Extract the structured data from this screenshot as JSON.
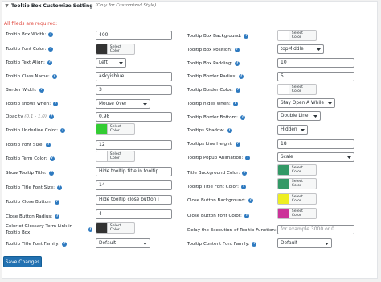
{
  "header": {
    "title": "Tooltip Box Customize Setting",
    "subtitle": "(Only for Customized Style)"
  },
  "required_note": "All fileds are required:",
  "color_button_label": "Select Color",
  "colors": {
    "tooltip_bg": "#ffffff",
    "font_color": "#333333",
    "border_color": "#ffffff",
    "underline": "#33cc33",
    "term_color": "#ffffff",
    "title_bg": "#339966",
    "title_font": "#339966",
    "close_btn_bg": "#eeee22",
    "close_btn_font": "#cc3399",
    "glossary_link": "#333333"
  },
  "left": {
    "box_width": {
      "label": "Tooltip Box Width:",
      "value": "400"
    },
    "font_color": {
      "label": "Tooltip Font Color:"
    },
    "text_align": {
      "label": "Tooltip Text Align:",
      "value": "Left"
    },
    "class_name": {
      "label": "Tooltip Class Name:",
      "value": "askyisblue"
    },
    "border_width": {
      "label": "Border Width:",
      "value": "3"
    },
    "shows_when": {
      "label": "Tooltip shows when:",
      "value": "Mouse Over"
    },
    "opacity": {
      "label": "Opacity",
      "hint": "(0.1 - 1.0)",
      "value": "0.98"
    },
    "underline_color": {
      "label": "Tooltip Underline Color:"
    },
    "font_size": {
      "label": "Tooltip Font Size:",
      "value": "12"
    },
    "term_color": {
      "label": "Tooltip Term Color:"
    },
    "show_title": {
      "label": "Show Tooltip Title:",
      "value": "Hide tooltip title in tooltip"
    },
    "title_font_size": {
      "label": "Tooltip Title Font Size:",
      "value": "14"
    },
    "close_button": {
      "label": "Tooltip Close Button:",
      "value": "Hide tooltip close button i"
    },
    "close_radius": {
      "label": "Close Button Radius:",
      "value": "4"
    },
    "glossary_color": {
      "label": "Color of Glossary Term Link in Tooltip Box:"
    },
    "title_font_family": {
      "label": "Tooltip Title Font Family:",
      "value": "Default"
    }
  },
  "right": {
    "box_bg": {
      "label": "Tooltip Box Background:"
    },
    "position": {
      "label": "Tooltip Box Position:",
      "value": "topMiddle"
    },
    "padding": {
      "label": "Tooltip Box Padding:",
      "value": "10"
    },
    "border_radius": {
      "label": "Tooltip Border Radius:",
      "value": "5"
    },
    "border_color": {
      "label": "Tooltip Border Color:"
    },
    "hides_when": {
      "label": "Tooltip hides when:",
      "value": "Stay Open A While"
    },
    "border_bottom": {
      "label": "Tooltip Border Bottom:",
      "value": "Double Line"
    },
    "shadow": {
      "label": "Tooltips Shadow:",
      "value": "Hidden"
    },
    "line_height": {
      "label": "Tooltips Line Height:",
      "value": "18"
    },
    "animation": {
      "label": "Tooltip Popup Animation:",
      "value": "Scale"
    },
    "title_bg": {
      "label": "Title Background Color:"
    },
    "title_font_color": {
      "label": "Tooltip Title Font Color:"
    },
    "close_bg": {
      "label": "Close Button Background:"
    },
    "close_font": {
      "label": "Close Button Font Color:"
    },
    "delay": {
      "label": "Delay the Execution of Tooltip Function:",
      "placeholder": "for example 3000 or 0"
    },
    "content_font_family": {
      "label": "Tooltip Content Font Family:",
      "value": "Default"
    }
  },
  "save_label": "Save Changes"
}
